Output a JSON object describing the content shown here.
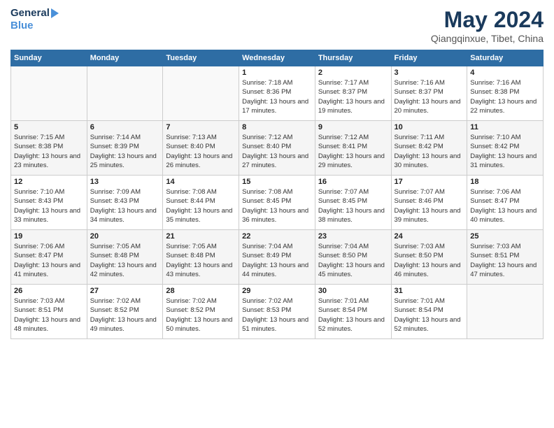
{
  "header": {
    "logo_line1": "General",
    "logo_line2": "Blue",
    "title": "May 2024",
    "location": "Qiangqinxue, Tibet, China"
  },
  "weekdays": [
    "Sunday",
    "Monday",
    "Tuesday",
    "Wednesday",
    "Thursday",
    "Friday",
    "Saturday"
  ],
  "weeks": [
    [
      {
        "day": "",
        "empty": true
      },
      {
        "day": "",
        "empty": true
      },
      {
        "day": "",
        "empty": true
      },
      {
        "day": "1",
        "sunrise": "7:18 AM",
        "sunset": "8:36 PM",
        "daylight": "13 hours and 17 minutes."
      },
      {
        "day": "2",
        "sunrise": "7:17 AM",
        "sunset": "8:37 PM",
        "daylight": "13 hours and 19 minutes."
      },
      {
        "day": "3",
        "sunrise": "7:16 AM",
        "sunset": "8:37 PM",
        "daylight": "13 hours and 20 minutes."
      },
      {
        "day": "4",
        "sunrise": "7:16 AM",
        "sunset": "8:38 PM",
        "daylight": "13 hours and 22 minutes."
      }
    ],
    [
      {
        "day": "5",
        "sunrise": "7:15 AM",
        "sunset": "8:38 PM",
        "daylight": "13 hours and 23 minutes."
      },
      {
        "day": "6",
        "sunrise": "7:14 AM",
        "sunset": "8:39 PM",
        "daylight": "13 hours and 25 minutes."
      },
      {
        "day": "7",
        "sunrise": "7:13 AM",
        "sunset": "8:40 PM",
        "daylight": "13 hours and 26 minutes."
      },
      {
        "day": "8",
        "sunrise": "7:12 AM",
        "sunset": "8:40 PM",
        "daylight": "13 hours and 27 minutes."
      },
      {
        "day": "9",
        "sunrise": "7:12 AM",
        "sunset": "8:41 PM",
        "daylight": "13 hours and 29 minutes."
      },
      {
        "day": "10",
        "sunrise": "7:11 AM",
        "sunset": "8:42 PM",
        "daylight": "13 hours and 30 minutes."
      },
      {
        "day": "11",
        "sunrise": "7:10 AM",
        "sunset": "8:42 PM",
        "daylight": "13 hours and 31 minutes."
      }
    ],
    [
      {
        "day": "12",
        "sunrise": "7:10 AM",
        "sunset": "8:43 PM",
        "daylight": "13 hours and 33 minutes."
      },
      {
        "day": "13",
        "sunrise": "7:09 AM",
        "sunset": "8:43 PM",
        "daylight": "13 hours and 34 minutes."
      },
      {
        "day": "14",
        "sunrise": "7:08 AM",
        "sunset": "8:44 PM",
        "daylight": "13 hours and 35 minutes."
      },
      {
        "day": "15",
        "sunrise": "7:08 AM",
        "sunset": "8:45 PM",
        "daylight": "13 hours and 36 minutes."
      },
      {
        "day": "16",
        "sunrise": "7:07 AM",
        "sunset": "8:45 PM",
        "daylight": "13 hours and 38 minutes."
      },
      {
        "day": "17",
        "sunrise": "7:07 AM",
        "sunset": "8:46 PM",
        "daylight": "13 hours and 39 minutes."
      },
      {
        "day": "18",
        "sunrise": "7:06 AM",
        "sunset": "8:47 PM",
        "daylight": "13 hours and 40 minutes."
      }
    ],
    [
      {
        "day": "19",
        "sunrise": "7:06 AM",
        "sunset": "8:47 PM",
        "daylight": "13 hours and 41 minutes."
      },
      {
        "day": "20",
        "sunrise": "7:05 AM",
        "sunset": "8:48 PM",
        "daylight": "13 hours and 42 minutes."
      },
      {
        "day": "21",
        "sunrise": "7:05 AM",
        "sunset": "8:48 PM",
        "daylight": "13 hours and 43 minutes."
      },
      {
        "day": "22",
        "sunrise": "7:04 AM",
        "sunset": "8:49 PM",
        "daylight": "13 hours and 44 minutes."
      },
      {
        "day": "23",
        "sunrise": "7:04 AM",
        "sunset": "8:50 PM",
        "daylight": "13 hours and 45 minutes."
      },
      {
        "day": "24",
        "sunrise": "7:03 AM",
        "sunset": "8:50 PM",
        "daylight": "13 hours and 46 minutes."
      },
      {
        "day": "25",
        "sunrise": "7:03 AM",
        "sunset": "8:51 PM",
        "daylight": "13 hours and 47 minutes."
      }
    ],
    [
      {
        "day": "26",
        "sunrise": "7:03 AM",
        "sunset": "8:51 PM",
        "daylight": "13 hours and 48 minutes."
      },
      {
        "day": "27",
        "sunrise": "7:02 AM",
        "sunset": "8:52 PM",
        "daylight": "13 hours and 49 minutes."
      },
      {
        "day": "28",
        "sunrise": "7:02 AM",
        "sunset": "8:52 PM",
        "daylight": "13 hours and 50 minutes."
      },
      {
        "day": "29",
        "sunrise": "7:02 AM",
        "sunset": "8:53 PM",
        "daylight": "13 hours and 51 minutes."
      },
      {
        "day": "30",
        "sunrise": "7:01 AM",
        "sunset": "8:54 PM",
        "daylight": "13 hours and 52 minutes."
      },
      {
        "day": "31",
        "sunrise": "7:01 AM",
        "sunset": "8:54 PM",
        "daylight": "13 hours and 52 minutes."
      },
      {
        "day": "",
        "empty": true
      }
    ]
  ],
  "labels": {
    "sunrise": "Sunrise:",
    "sunset": "Sunset:",
    "daylight": "Daylight hours"
  }
}
